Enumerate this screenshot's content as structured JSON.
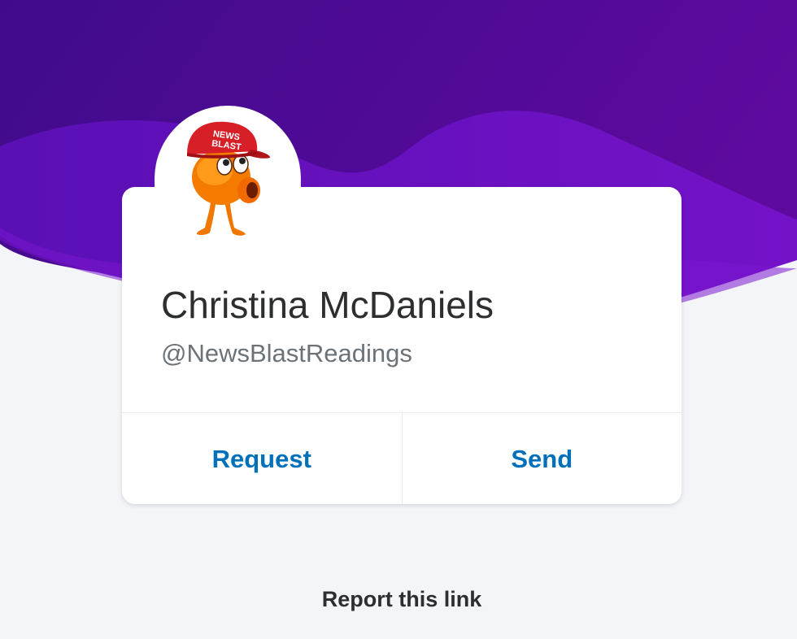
{
  "profile": {
    "name": "Christina McDaniels",
    "handle": "@NewsBlastReadings",
    "avatar_hat_text_line1": "NEWS",
    "avatar_hat_text_line2": "BLAST"
  },
  "actions": {
    "request_label": "Request",
    "send_label": "Send"
  },
  "footer": {
    "report_label": "Report this link"
  },
  "colors": {
    "hero_dark": "#3f0b8c",
    "hero_light": "#6a0dbf",
    "accent": "#0070ba",
    "text_primary": "#2c2e2f",
    "text_secondary": "#6c7378",
    "background": "#f3f5f8"
  }
}
